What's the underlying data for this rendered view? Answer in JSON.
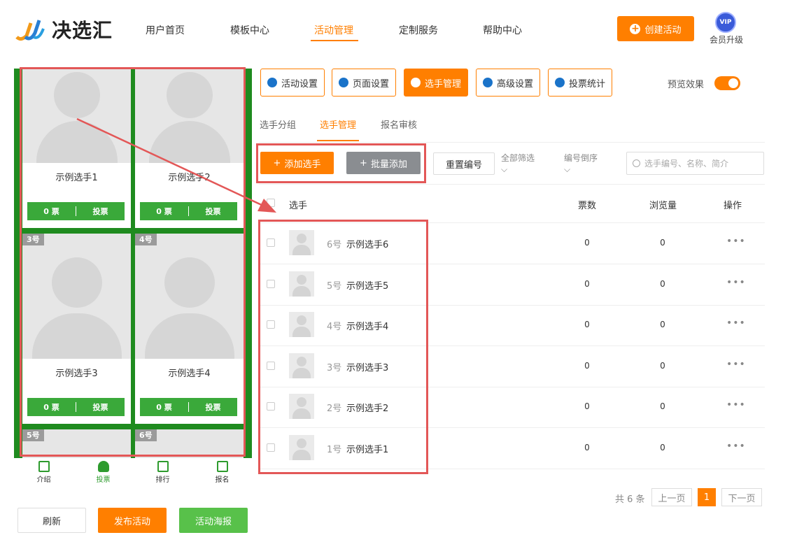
{
  "header": {
    "logo_text": "决选汇",
    "nav": [
      "用户首页",
      "模板中心",
      "活动管理",
      "定制服务",
      "帮助中心"
    ],
    "create_button": "创建活动",
    "vip_badge": "VIP",
    "vip_label": "会员升级"
  },
  "preview": {
    "cards": [
      {
        "name": "示例选手1",
        "votes": "0 票",
        "vote_label": "投票",
        "badge": ""
      },
      {
        "name": "示例选手2",
        "votes": "0 票",
        "vote_label": "投票",
        "badge": ""
      },
      {
        "name": "示例选手3",
        "votes": "0 票",
        "vote_label": "投票",
        "badge": "3号"
      },
      {
        "name": "示例选手4",
        "votes": "0 票",
        "vote_label": "投票",
        "badge": "4号"
      },
      {
        "name": "",
        "votes": "",
        "vote_label": "",
        "badge": "5号"
      },
      {
        "name": "",
        "votes": "",
        "vote_label": "",
        "badge": "6号"
      }
    ],
    "tabs": [
      "介绍",
      "投票",
      "排行",
      "报名"
    ],
    "buttons": {
      "refresh": "刷新",
      "publish": "发布活动",
      "poster": "活动海报"
    }
  },
  "toolbar": {
    "buttons": [
      "活动设置",
      "页面设置",
      "选手管理",
      "高级设置",
      "投票统计"
    ],
    "preview_label": "预览效果"
  },
  "subtabs": [
    "选手分组",
    "选手管理",
    "报名审核"
  ],
  "actions": {
    "add": "添加选手",
    "batch": "批量添加",
    "reset": "重置编号",
    "filter": "全部筛选",
    "sort": "编号倒序",
    "search_placeholder": "选手编号、名称、简介"
  },
  "table": {
    "headers": {
      "player": "选手",
      "votes": "票数",
      "views": "浏览量",
      "ops": "操作"
    },
    "rows": [
      {
        "num": "6号",
        "name": "示例选手6",
        "votes": "0",
        "views": "0",
        "more": "•••"
      },
      {
        "num": "5号",
        "name": "示例选手5",
        "votes": "0",
        "views": "0",
        "more": "•••"
      },
      {
        "num": "4号",
        "name": "示例选手4",
        "votes": "0",
        "views": "0",
        "more": "•••"
      },
      {
        "num": "3号",
        "name": "示例选手3",
        "votes": "0",
        "views": "0",
        "more": "•••"
      },
      {
        "num": "2号",
        "name": "示例选手2",
        "votes": "0",
        "views": "0",
        "more": "•••"
      },
      {
        "num": "1号",
        "name": "示例选手1",
        "votes": "0",
        "views": "0",
        "more": "•••"
      }
    ]
  },
  "pagination": {
    "total": "共 6 条",
    "prev": "上一页",
    "current": "1",
    "next": "下一页"
  },
  "colors": {
    "accent": "#ff7f00",
    "green": "#1f8b1f",
    "highlight": "#e35757"
  }
}
